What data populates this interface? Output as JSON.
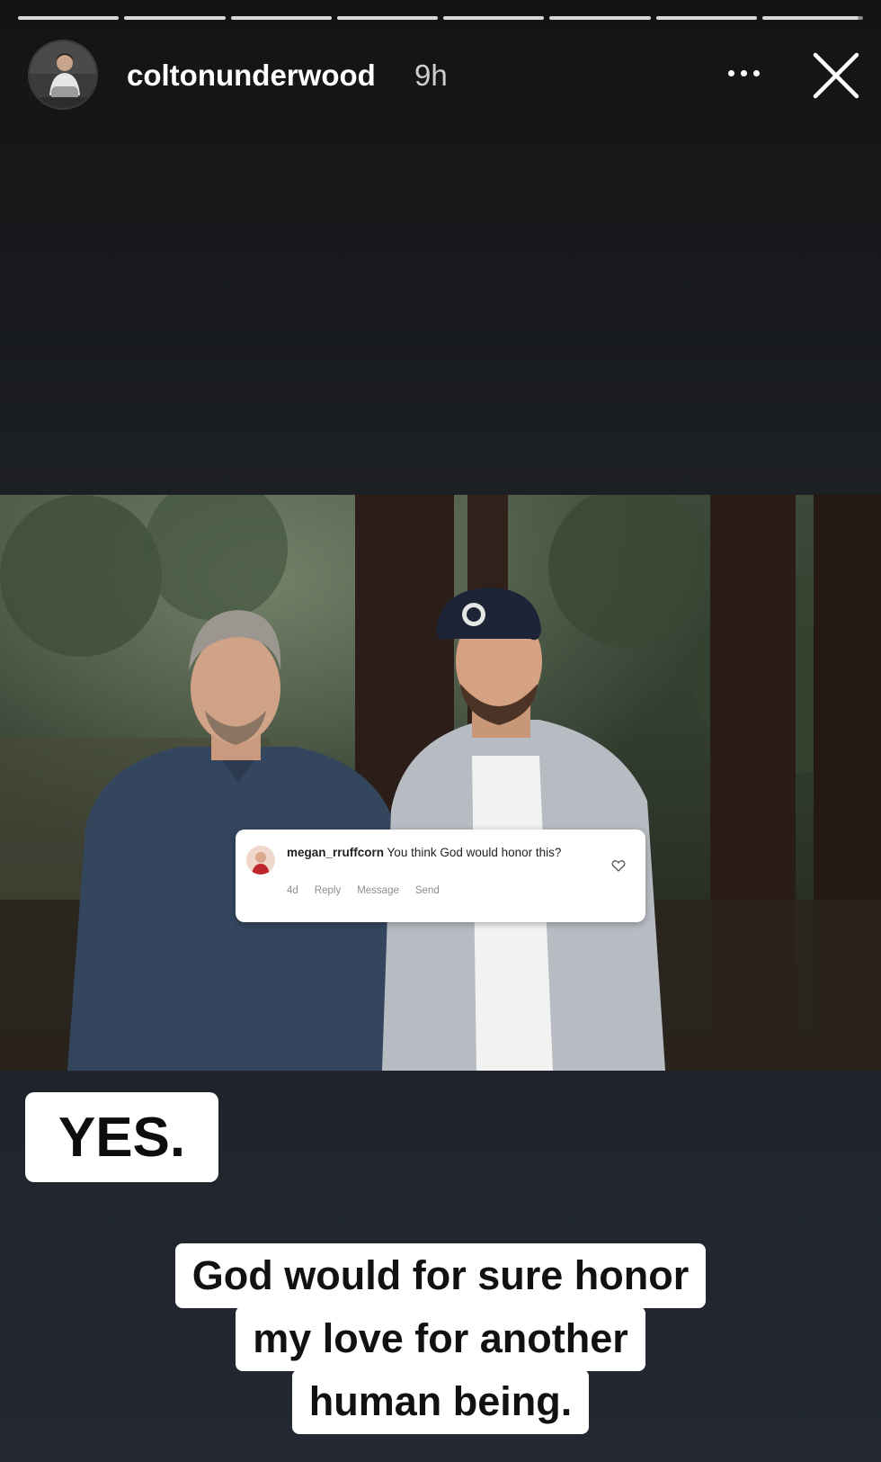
{
  "story": {
    "progress": {
      "segments": 8,
      "completed": 7,
      "current_fraction": 0.95
    },
    "header": {
      "username": "coltonunderwood",
      "time": "9h",
      "more_icon": "more-horizontal-icon",
      "close_icon": "close-icon"
    },
    "comment_card": {
      "username": "megan_rruffcorn",
      "text": "You think God would honor this?",
      "age": "4d",
      "actions": [
        "Reply",
        "Message",
        "Send"
      ],
      "like_icon": "heart-outline-icon"
    },
    "stickers": {
      "yes": "YES.",
      "caption_lines": [
        "God would for sure honor",
        "my love for another",
        "human being."
      ]
    }
  }
}
